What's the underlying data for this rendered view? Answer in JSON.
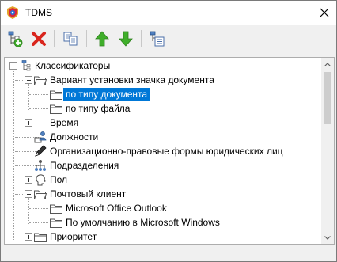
{
  "window": {
    "title": "TDMS"
  },
  "toolbar": {
    "buttons": [
      {
        "name": "add-classifier-button",
        "icon": "add-tree-icon"
      },
      {
        "name": "delete-button",
        "icon": "red-x-icon"
      },
      {
        "name": "copy-button",
        "icon": "copy-docs-icon"
      },
      {
        "name": "move-up-button",
        "icon": "green-arrow-up-icon"
      },
      {
        "name": "move-down-button",
        "icon": "green-arrow-down-icon"
      },
      {
        "name": "properties-button",
        "icon": "tree-properties-icon"
      }
    ]
  },
  "tree": {
    "root": "Классификаторы",
    "items": [
      {
        "label": "Вариант установки значка документа",
        "icon": "folder-open-icon",
        "expanded": true
      },
      {
        "label": "по типу документа",
        "icon": "folder-icon",
        "selected": true
      },
      {
        "label": "по типу файла",
        "icon": "folder-icon"
      },
      {
        "label": "Время",
        "icon": "none"
      },
      {
        "label": "Должности",
        "icon": "position-icon"
      },
      {
        "label": "Организационно-правовые формы юридических лиц",
        "icon": "pen-icon"
      },
      {
        "label": "Подразделения",
        "icon": "org-structure-icon"
      },
      {
        "label": "Пол",
        "icon": "person-head-icon"
      },
      {
        "label": "Почтовый клиент",
        "icon": "folder-open-icon",
        "expanded": true
      },
      {
        "label": "Microsoft Office Outlook",
        "icon": "folder-icon"
      },
      {
        "label": "По умолчанию в Microsoft Windows",
        "icon": "folder-icon"
      },
      {
        "label": "Приоритет",
        "icon": "folder-icon"
      }
    ]
  },
  "colors": {
    "selection": "#0078d7",
    "arrow_green": "#3fae2a",
    "delete_red": "#d9251d"
  }
}
